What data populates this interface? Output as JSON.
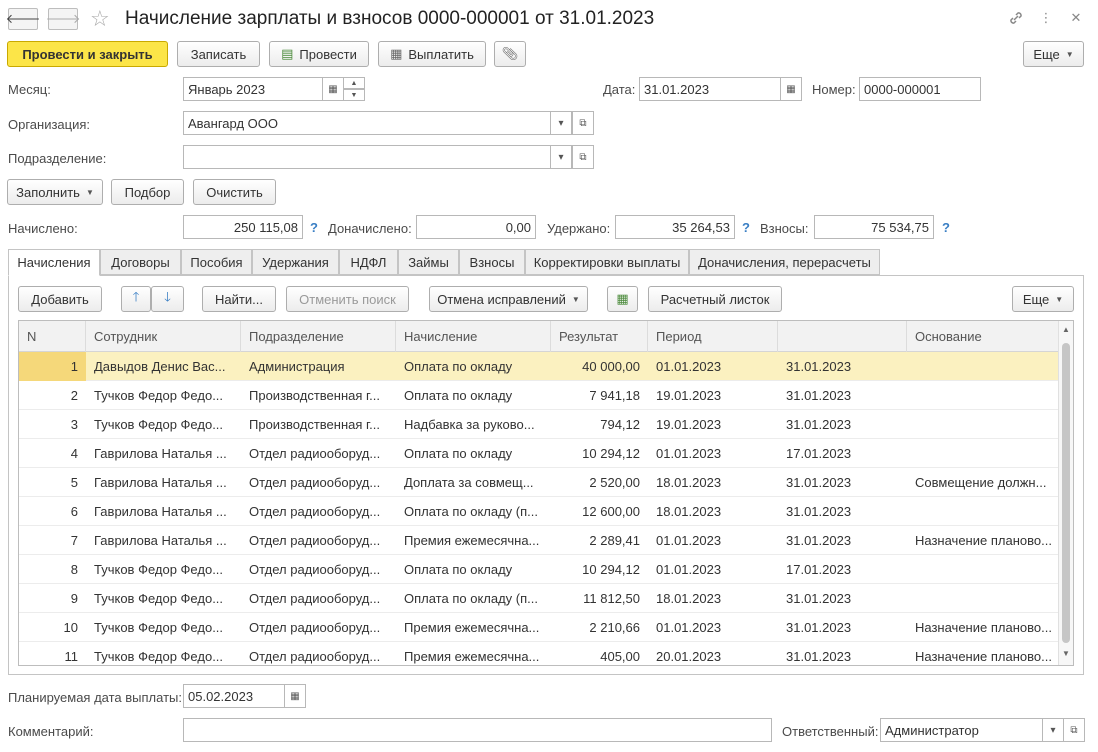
{
  "window": {
    "title": "Начисление зарплаты и взносов 0000-000001 от 31.01.2023"
  },
  "toolbar": {
    "post_close": "Провести и закрыть",
    "save": "Записать",
    "post": "Провести",
    "pay": "Выплатить",
    "more": "Еще"
  },
  "header": {
    "month_label": "Месяц:",
    "month_value": "Январь 2023",
    "date_label": "Дата:",
    "date_value": "31.01.2023",
    "number_label": "Номер:",
    "number_value": "0000-000001",
    "org_label": "Организация:",
    "org_value": "Авангард ООО",
    "dept_label": "Подразделение:",
    "dept_value": ""
  },
  "actions": {
    "fill": "Заполнить",
    "select": "Подбор",
    "clear": "Очистить"
  },
  "totals": {
    "accrued_label": "Начислено:",
    "accrued_value": "250 115,08",
    "extra_label": "Доначислено:",
    "extra_value": "0,00",
    "withheld_label": "Удержано:",
    "withheld_value": "35 264,53",
    "contrib_label": "Взносы:",
    "contrib_value": "75 534,75",
    "help": "?"
  },
  "tabs": [
    "Начисления",
    "Договоры",
    "Пособия",
    "Удержания",
    "НДФЛ",
    "Займы",
    "Взносы",
    "Корректировки выплаты",
    "Доначисления, перерасчеты"
  ],
  "table_toolbar": {
    "add": "Добавить",
    "find": "Найти...",
    "cancel_search": "Отменить поиск",
    "cancel_corrections": "Отмена исправлений",
    "payslip": "Расчетный листок",
    "more": "Еще"
  },
  "columns": [
    "N",
    "Сотрудник",
    "Подразделение",
    "Начисление",
    "Результат",
    "Период",
    "",
    "Основание"
  ],
  "rows": [
    [
      "1",
      "Давыдов Денис Вас...",
      "Администрация",
      "Оплата по окладу",
      "40 000,00",
      "01.01.2023",
      "31.01.2023",
      ""
    ],
    [
      "2",
      "Тучков Федор Федо...",
      "Производственная г...",
      "Оплата по окладу",
      "7 941,18",
      "19.01.2023",
      "31.01.2023",
      ""
    ],
    [
      "3",
      "Тучков Федор Федо...",
      "Производственная г...",
      "Надбавка за руково...",
      "794,12",
      "19.01.2023",
      "31.01.2023",
      ""
    ],
    [
      "4",
      "Гаврилова Наталья ...",
      "Отдел радиооборуд...",
      "Оплата по окладу",
      "10 294,12",
      "01.01.2023",
      "17.01.2023",
      ""
    ],
    [
      "5",
      "Гаврилова Наталья ...",
      "Отдел радиооборуд...",
      "Доплата за совмещ...",
      "2 520,00",
      "18.01.2023",
      "31.01.2023",
      "Совмещение должн..."
    ],
    [
      "6",
      "Гаврилова Наталья ...",
      "Отдел радиооборуд...",
      "Оплата по окладу (п...",
      "12 600,00",
      "18.01.2023",
      "31.01.2023",
      ""
    ],
    [
      "7",
      "Гаврилова Наталья ...",
      "Отдел радиооборуд...",
      "Премия ежемесячна...",
      "2 289,41",
      "01.01.2023",
      "31.01.2023",
      "Назначение планово..."
    ],
    [
      "8",
      "Тучков Федор Федо...",
      "Отдел радиооборуд...",
      "Оплата по окладу",
      "10 294,12",
      "01.01.2023",
      "17.01.2023",
      ""
    ],
    [
      "9",
      "Тучков Федор Федо...",
      "Отдел радиооборуд...",
      "Оплата по окладу (п...",
      "11 812,50",
      "18.01.2023",
      "31.01.2023",
      ""
    ],
    [
      "10",
      "Тучков Федор Федо...",
      "Отдел радиооборуд...",
      "Премия ежемесячна...",
      "2 210,66",
      "01.01.2023",
      "31.01.2023",
      "Назначение планово..."
    ],
    [
      "11",
      "Тучков Федор Федо...",
      "Отдел радиооборуд...",
      "Премия ежемесячна...",
      "405,00",
      "20.01.2023",
      "31.01.2023",
      "Назначение планово..."
    ]
  ],
  "footer": {
    "paydate_label": "Планируемая дата выплаты:",
    "paydate_value": "05.02.2023",
    "comment_label": "Комментарий:",
    "comment_value": "",
    "responsible_label": "Ответственный:",
    "responsible_value": "Администратор"
  },
  "colors": {
    "primary_button": "#fce548",
    "selected_row": "#fbf1c0",
    "help_link": "#3a7fc4"
  }
}
